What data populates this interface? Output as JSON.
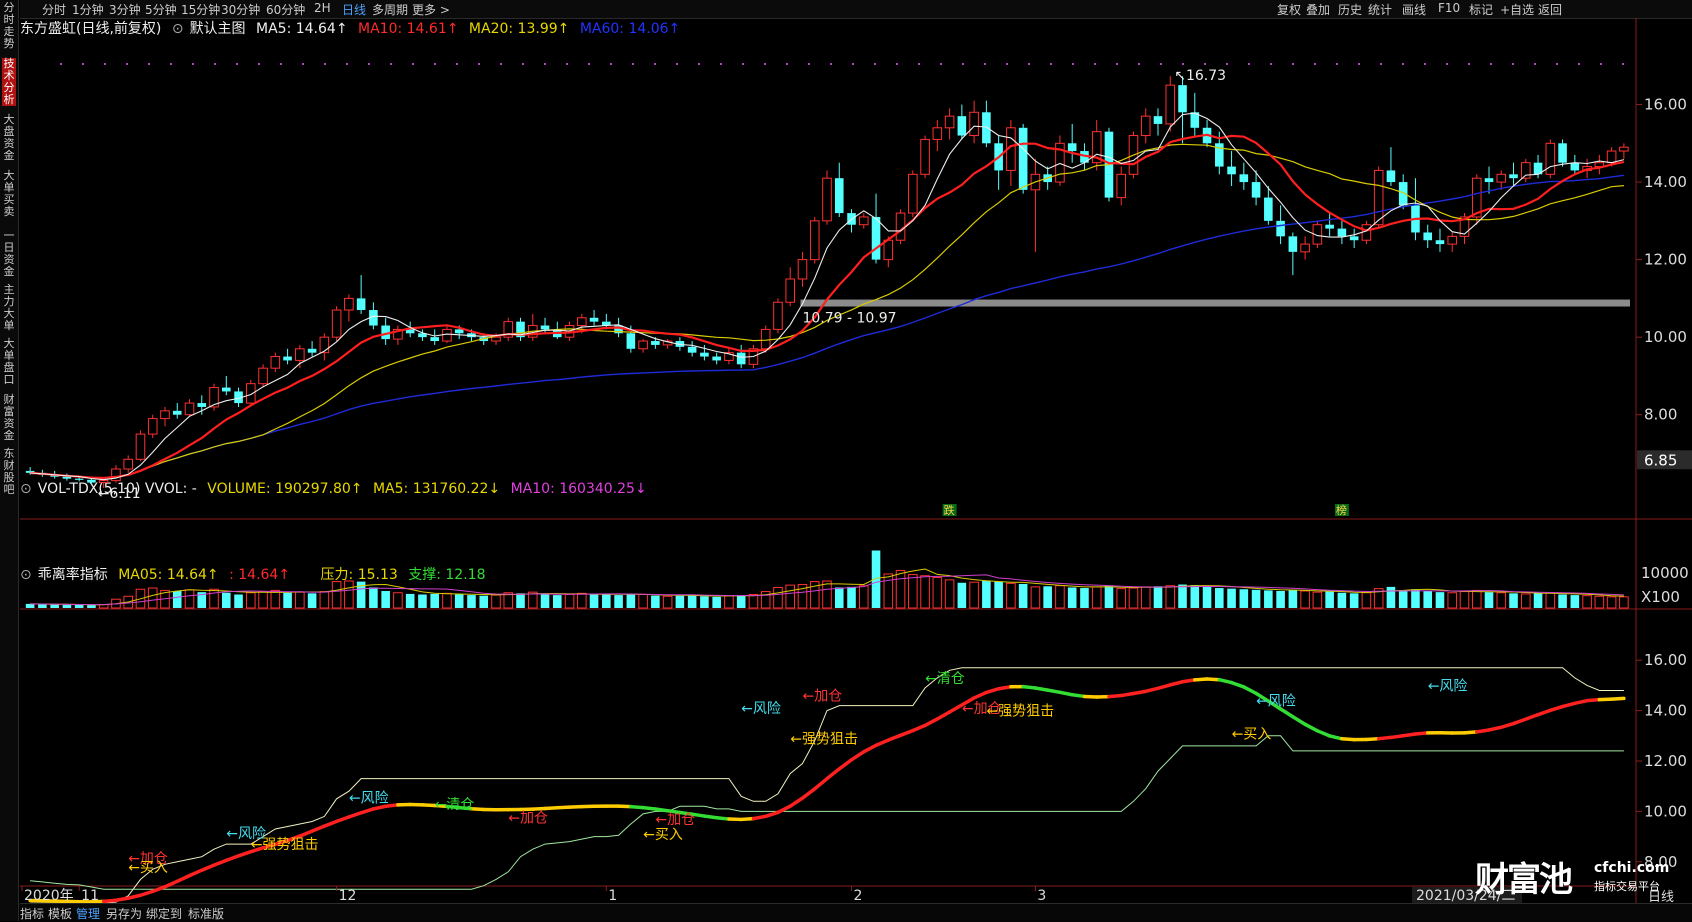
{
  "sidebar": [
    {
      "label": "分时走势",
      "active": false
    },
    {
      "label": "技术分析",
      "active": true
    },
    {
      "label": "大盘资金",
      "active": false
    },
    {
      "label": "大单买卖",
      "active": false
    },
    {
      "label": "一日资金",
      "active": false
    },
    {
      "label": "主力大单",
      "active": false
    },
    {
      "label": "大单盘口",
      "active": false
    },
    {
      "label": "财富资金",
      "active": false
    },
    {
      "label": "东财股吧",
      "active": false
    }
  ],
  "timeframes": [
    "分时",
    "1分钟",
    "3分钟",
    "5分钟",
    "15分钟",
    "30分钟",
    "60分钟",
    "2H",
    "日线",
    "多周期",
    "更多 >"
  ],
  "active_timeframe": "日线",
  "right_tools": [
    "复权",
    "叠加",
    "历史",
    "统计",
    "画线",
    "F10",
    "标记",
    "+自选",
    "返回"
  ],
  "main_legend": {
    "name": "东方盛虹(日线,前复权)",
    "template": "默认主图",
    "ma5": "MA5: 14.64↑",
    "ma10": "MA10: 14.61↑",
    "ma20": "MA20: 13.99↑",
    "ma60": "MA60: 14.06↑"
  },
  "vol_legend": {
    "name": "VOL-TDX(5,10) VVOL: -",
    "volume": "VOLUME: 190297.80↑",
    "ma5": "MA5: 131760.22↓",
    "ma10": "MA10: 160340.25↓"
  },
  "ind_legend": {
    "name": "乖离率指标",
    "ma05": "MA05: 14.64↑",
    "v2": ": 14.64↑",
    "pressure": "压力: 15.13",
    "support": "支撑: 12.18"
  },
  "main_axis": [
    "16.00",
    "14.00",
    "12.00",
    "10.00",
    "8.00"
  ],
  "current_price": "6.85",
  "vol_axis": [
    "10000",
    "X100"
  ],
  "ind_axis": [
    "16.00",
    "14.00",
    "12.00",
    "10.00",
    "8.00"
  ],
  "x_labels": [
    {
      "label": "2020年",
      "i": 0
    },
    {
      "label": "11",
      "i": 4
    },
    {
      "label": "12",
      "i": 25
    },
    {
      "label": "1",
      "i": 47
    },
    {
      "label": "2",
      "i": 67
    },
    {
      "label": "3",
      "i": 82
    }
  ],
  "date_badge": "2021/03/24/二",
  "brand": {
    "logo": "财富池",
    "url": "cfchi.com",
    "tagline": "指标交易平台"
  },
  "period_label": "日线",
  "bottom_tabs": [
    "指标",
    "模板",
    "管理",
    "另存为",
    "绑定到",
    "标准版"
  ],
  "annotations": {
    "high": "16.73",
    "low": "6.11",
    "gap": "10.79 - 10.97",
    "mark1": "跌",
    "mark2": "榜"
  },
  "indicator_signals": [
    {
      "text": "←加仓",
      "color": "#ff3333",
      "i": 8,
      "v": 7.95
    },
    {
      "text": "←买入",
      "color": "#ffcc00",
      "i": 8,
      "v": 7.6
    },
    {
      "text": "←风险",
      "color": "#44ddee",
      "i": 16,
      "v": 8.95
    },
    {
      "text": "←强势狙击",
      "color": "#ffcc00",
      "i": 18,
      "v": 8.5
    },
    {
      "text": "←风险",
      "color": "#44ddee",
      "i": 26,
      "v": 10.35
    },
    {
      "text": "←清仓",
      "color": "#33dd33",
      "i": 33,
      "v": 10.1
    },
    {
      "text": "←加仓",
      "color": "#ff3333",
      "i": 39,
      "v": 9.55
    },
    {
      "text": "←加仓",
      "color": "#ff3333",
      "i": 51,
      "v": 9.5
    },
    {
      "text": "←买入",
      "color": "#ffcc00",
      "i": 50,
      "v": 8.9
    },
    {
      "text": "←风险",
      "color": "#44ddee",
      "i": 58,
      "v": 13.9
    },
    {
      "text": "←强势狙击",
      "color": "#ffcc00",
      "i": 62,
      "v": 12.7
    },
    {
      "text": "←加仓",
      "color": "#ff3333",
      "i": 63,
      "v": 14.4
    },
    {
      "text": "←清仓",
      "color": "#33dd33",
      "i": 73,
      "v": 15.1
    },
    {
      "text": "←加仓",
      "color": "#ff3333",
      "i": 76,
      "v": 13.9
    },
    {
      "text": "←强势狙击",
      "color": "#ffcc00",
      "i": 78,
      "v": 13.8
    },
    {
      "text": "←买入",
      "color": "#ffcc00",
      "i": 98,
      "v": 12.9
    },
    {
      "text": "←风险",
      "color": "#44ddee",
      "i": 100,
      "v": 14.2
    },
    {
      "text": "←风险",
      "color": "#44ddee",
      "i": 114,
      "v": 14.8
    }
  ],
  "chart_data": {
    "type": "candlestick",
    "ylim": [
      5.8,
      17.2
    ],
    "vol_ylim": [
      0,
      15000
    ],
    "ind_ylim": [
      6.8,
      17.2
    ],
    "candles": [
      [
        6.55,
        6.65,
        6.45,
        6.5
      ],
      [
        6.5,
        6.58,
        6.4,
        6.45
      ],
      [
        6.45,
        6.55,
        6.35,
        6.4
      ],
      [
        6.4,
        6.48,
        6.3,
        6.35
      ],
      [
        6.35,
        6.42,
        6.28,
        6.32
      ],
      [
        6.32,
        6.4,
        6.2,
        6.25
      ],
      [
        6.25,
        6.35,
        6.11,
        6.3
      ],
      [
        6.3,
        6.7,
        6.25,
        6.6
      ],
      [
        6.6,
        6.95,
        6.5,
        6.85
      ],
      [
        6.85,
        7.6,
        6.8,
        7.5
      ],
      [
        7.5,
        8.0,
        7.4,
        7.9
      ],
      [
        7.9,
        8.2,
        7.7,
        8.1
      ],
      [
        8.1,
        8.3,
        7.9,
        8.0
      ],
      [
        8.0,
        8.4,
        7.95,
        8.3
      ],
      [
        8.3,
        8.5,
        8.0,
        8.2
      ],
      [
        8.2,
        8.8,
        8.1,
        8.7
      ],
      [
        8.7,
        9.0,
        8.5,
        8.6
      ],
      [
        8.6,
        8.7,
        8.2,
        8.3
      ],
      [
        8.3,
        8.9,
        8.25,
        8.8
      ],
      [
        8.8,
        9.3,
        8.7,
        9.2
      ],
      [
        9.2,
        9.6,
        9.1,
        9.5
      ],
      [
        9.5,
        9.7,
        9.3,
        9.4
      ],
      [
        9.4,
        9.8,
        9.2,
        9.7
      ],
      [
        9.7,
        9.9,
        9.5,
        9.6
      ],
      [
        9.6,
        10.1,
        9.4,
        10.0
      ],
      [
        10.0,
        10.8,
        9.9,
        10.7
      ],
      [
        10.7,
        11.1,
        10.4,
        11.0
      ],
      [
        11.0,
        11.6,
        10.6,
        10.7
      ],
      [
        10.7,
        10.9,
        10.2,
        10.3
      ],
      [
        10.3,
        10.5,
        9.8,
        9.95
      ],
      [
        9.95,
        10.3,
        9.8,
        10.2
      ],
      [
        10.2,
        10.4,
        10.0,
        10.1
      ],
      [
        10.1,
        10.2,
        9.9,
        10.0
      ],
      [
        10.0,
        10.2,
        9.8,
        9.9
      ],
      [
        9.9,
        10.3,
        9.85,
        10.2
      ],
      [
        10.2,
        10.3,
        9.95,
        10.1
      ],
      [
        10.1,
        10.2,
        9.9,
        10.0
      ],
      [
        10.0,
        10.1,
        9.8,
        9.9
      ],
      [
        9.9,
        10.1,
        9.8,
        10.0
      ],
      [
        10.0,
        10.5,
        9.9,
        10.4
      ],
      [
        10.4,
        10.5,
        9.9,
        10.0
      ],
      [
        10.0,
        10.6,
        9.9,
        10.3
      ],
      [
        10.3,
        10.5,
        10.1,
        10.2
      ],
      [
        10.2,
        10.4,
        9.95,
        10.0
      ],
      [
        10.0,
        10.4,
        9.9,
        10.3
      ],
      [
        10.3,
        10.6,
        10.1,
        10.5
      ],
      [
        10.5,
        10.7,
        10.3,
        10.4
      ],
      [
        10.4,
        10.6,
        10.2,
        10.3
      ],
      [
        10.3,
        10.5,
        10.0,
        10.1
      ],
      [
        10.1,
        10.3,
        9.6,
        9.7
      ],
      [
        9.7,
        9.95,
        9.6,
        9.9
      ],
      [
        9.9,
        10.0,
        9.7,
        9.8
      ],
      [
        9.8,
        9.95,
        9.7,
        9.9
      ],
      [
        9.9,
        10.0,
        9.65,
        9.75
      ],
      [
        9.75,
        9.9,
        9.5,
        9.6
      ],
      [
        9.6,
        9.8,
        9.4,
        9.5
      ],
      [
        9.5,
        9.6,
        9.3,
        9.4
      ],
      [
        9.4,
        9.7,
        9.3,
        9.6
      ],
      [
        9.6,
        9.8,
        9.2,
        9.3
      ],
      [
        9.3,
        9.8,
        9.2,
        9.7
      ],
      [
        9.7,
        10.3,
        9.6,
        10.2
      ],
      [
        10.2,
        11.0,
        10.1,
        10.9
      ],
      [
        10.9,
        11.8,
        10.8,
        11.5
      ],
      [
        11.5,
        12.2,
        11.3,
        12.0
      ],
      [
        12.0,
        13.1,
        11.9,
        13.0
      ],
      [
        13.0,
        14.3,
        12.9,
        14.1
      ],
      [
        14.1,
        14.5,
        13.1,
        13.2
      ],
      [
        13.2,
        13.3,
        12.7,
        12.9
      ],
      [
        12.9,
        13.2,
        12.8,
        13.1
      ],
      [
        13.1,
        13.7,
        11.9,
        12.0
      ],
      [
        12.0,
        12.6,
        11.8,
        12.5
      ],
      [
        12.5,
        13.3,
        12.4,
        13.2
      ],
      [
        13.2,
        14.3,
        13.1,
        14.2
      ],
      [
        14.2,
        15.2,
        14.1,
        15.1
      ],
      [
        15.1,
        15.6,
        14.8,
        15.4
      ],
      [
        15.4,
        15.9,
        15.1,
        15.7
      ],
      [
        15.7,
        16.0,
        15.1,
        15.2
      ],
      [
        15.2,
        16.1,
        15.0,
        15.8
      ],
      [
        15.8,
        16.1,
        14.9,
        15.0
      ],
      [
        15.0,
        15.2,
        13.8,
        14.3
      ],
      [
        14.3,
        15.6,
        13.9,
        15.4
      ],
      [
        15.4,
        15.5,
        13.7,
        13.8
      ],
      [
        13.8,
        14.6,
        12.2,
        14.2
      ],
      [
        14.2,
        14.4,
        13.8,
        14.0
      ],
      [
        14.0,
        15.2,
        13.9,
        15.0
      ],
      [
        15.0,
        15.5,
        14.5,
        14.8
      ],
      [
        14.8,
        15.0,
        14.3,
        14.5
      ],
      [
        14.5,
        15.6,
        14.3,
        15.3
      ],
      [
        15.3,
        15.4,
        13.5,
        13.6
      ],
      [
        13.6,
        14.4,
        13.4,
        14.2
      ],
      [
        14.2,
        15.3,
        14.1,
        15.2
      ],
      [
        15.2,
        15.9,
        15.0,
        15.7
      ],
      [
        15.7,
        15.9,
        15.2,
        15.5
      ],
      [
        15.5,
        16.73,
        15.3,
        16.5
      ],
      [
        16.5,
        16.73,
        15.0,
        15.8
      ],
      [
        15.8,
        16.3,
        15.2,
        15.4
      ],
      [
        15.4,
        15.6,
        14.9,
        15.0
      ],
      [
        15.0,
        15.3,
        14.2,
        14.4
      ],
      [
        14.4,
        14.8,
        13.9,
        14.2
      ],
      [
        14.2,
        14.5,
        13.8,
        14.0
      ],
      [
        14.0,
        14.3,
        13.4,
        13.6
      ],
      [
        13.6,
        13.9,
        12.9,
        13.0
      ],
      [
        13.0,
        13.4,
        12.4,
        12.6
      ],
      [
        12.6,
        12.7,
        11.6,
        12.2
      ],
      [
        12.2,
        12.6,
        12.0,
        12.4
      ],
      [
        12.4,
        13.0,
        12.3,
        12.9
      ],
      [
        12.9,
        13.2,
        12.6,
        12.8
      ],
      [
        12.8,
        13.0,
        12.4,
        12.6
      ],
      [
        12.6,
        12.8,
        12.3,
        12.5
      ],
      [
        12.5,
        13.0,
        12.4,
        12.9
      ],
      [
        12.9,
        14.4,
        12.8,
        14.3
      ],
      [
        14.3,
        14.9,
        13.9,
        14.0
      ],
      [
        14.0,
        14.2,
        13.3,
        13.4
      ],
      [
        13.4,
        14.1,
        12.5,
        12.7
      ],
      [
        12.7,
        12.9,
        12.3,
        12.5
      ],
      [
        12.5,
        12.8,
        12.2,
        12.4
      ],
      [
        12.4,
        12.7,
        12.2,
        12.6
      ],
      [
        12.6,
        13.2,
        12.4,
        13.1
      ],
      [
        13.1,
        14.2,
        12.9,
        14.1
      ],
      [
        14.1,
        14.4,
        13.7,
        14.0
      ],
      [
        14.0,
        14.3,
        13.8,
        14.2
      ],
      [
        14.2,
        14.5,
        13.9,
        14.1
      ],
      [
        14.1,
        14.6,
        14.0,
        14.5
      ],
      [
        14.5,
        14.7,
        14.1,
        14.2
      ],
      [
        14.2,
        15.1,
        14.1,
        15.0
      ],
      [
        15.0,
        15.1,
        14.4,
        14.5
      ],
      [
        14.5,
        14.7,
        14.2,
        14.3
      ],
      [
        14.3,
        14.6,
        14.1,
        14.4
      ],
      [
        14.4,
        14.7,
        14.2,
        14.5
      ],
      [
        14.5,
        14.9,
        14.4,
        14.8
      ],
      [
        14.8,
        15.0,
        14.6,
        14.9
      ]
    ],
    "volume": [
      700,
      650,
      600,
      550,
      520,
      500,
      600,
      1500,
      2000,
      3200,
      3400,
      3000,
      2900,
      3100,
      2700,
      3200,
      2600,
      2300,
      2600,
      2800,
      3000,
      2600,
      2700,
      2500,
      2800,
      4500,
      4600,
      4500,
      3500,
      2900,
      2600,
      2400,
      2300,
      2400,
      2500,
      2300,
      2200,
      2100,
      2200,
      2600,
      2500,
      2700,
      2300,
      2200,
      2300,
      2500,
      2400,
      2300,
      2200,
      2400,
      2300,
      2100,
      2000,
      2100,
      2200,
      2000,
      1900,
      2100,
      2200,
      2300,
      2800,
      3500,
      3900,
      4000,
      4500,
      4600,
      3500,
      3600,
      3800,
      9800,
      5800,
      6400,
      5700,
      5500,
      5200,
      4800,
      4300,
      4400,
      4600,
      4500,
      4200,
      4100,
      3600,
      3700,
      3800,
      3500,
      3400,
      3600,
      3800,
      3300,
      3400,
      3600,
      3700,
      3800,
      4000,
      3900,
      3700,
      3400,
      3300,
      3200,
      3100,
      3000,
      2900,
      3100,
      2900,
      2700,
      2800,
      2600,
      2500,
      2600,
      3300,
      3600,
      3000,
      3200,
      2900,
      2700,
      2600,
      2800,
      3000,
      2700,
      2600,
      2500,
      2400,
      2500,
      2600,
      2300,
      2200,
      2100,
      2000,
      1900,
      1900
    ],
    "indicator_signals_count": 18
  }
}
